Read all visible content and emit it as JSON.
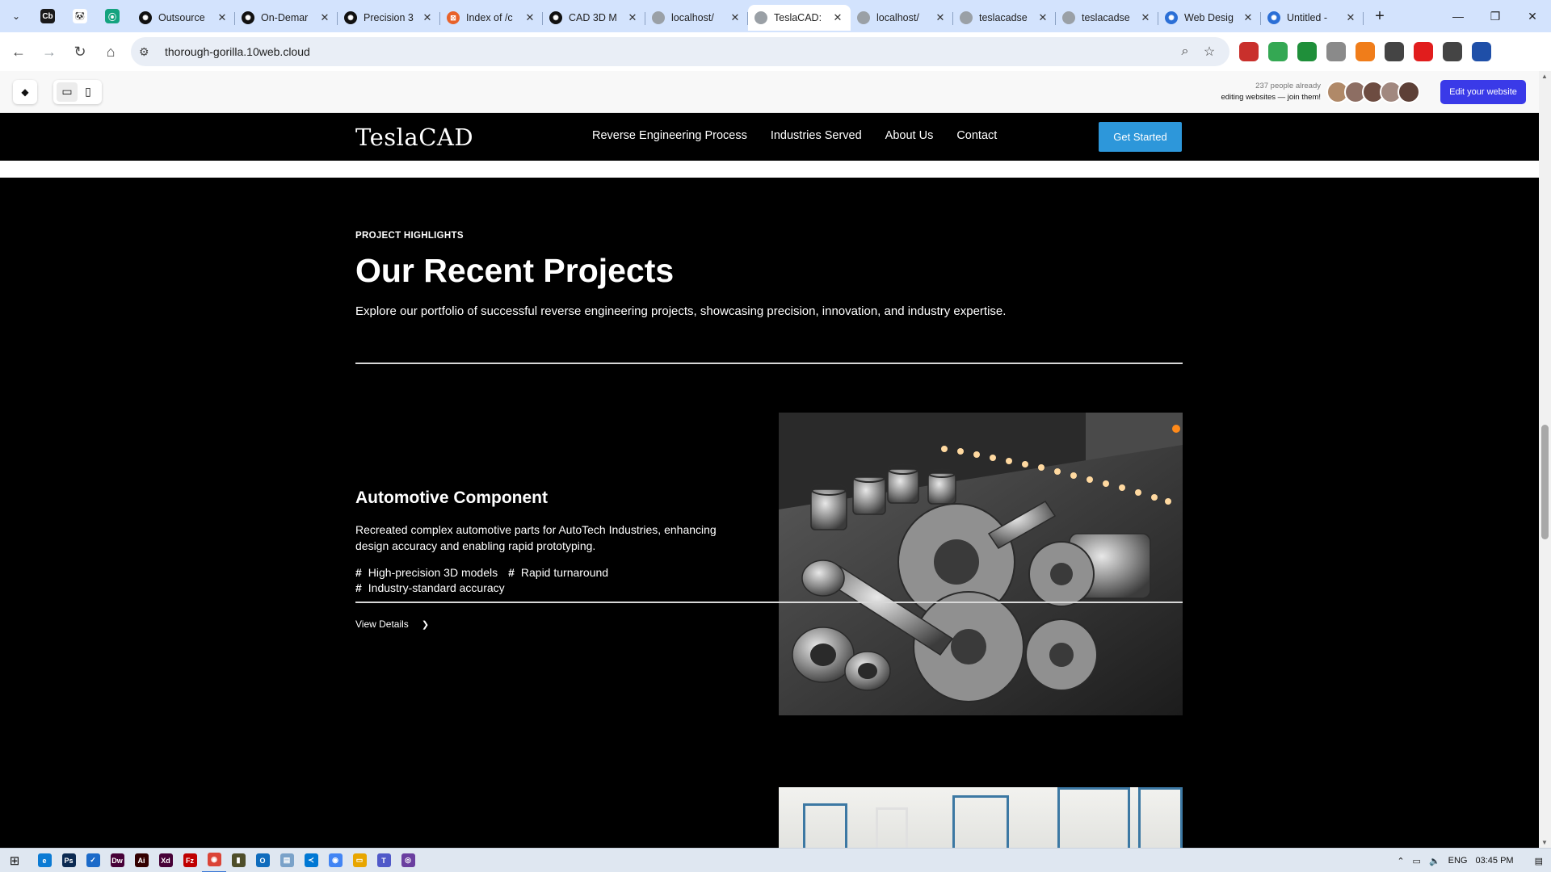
{
  "browser": {
    "pinned": [
      {
        "label": "Cb",
        "color": "#1a1a1a"
      },
      {
        "label": "🐼",
        "color": "#ffffff"
      },
      {
        "label": "⦿",
        "color": "#14a37f"
      }
    ],
    "tabs": [
      {
        "title": "Outsource",
        "color": "#111111",
        "glyph": "✺",
        "active": false
      },
      {
        "title": "On-Demar",
        "color": "#111111",
        "glyph": "✺",
        "active": false
      },
      {
        "title": "Precision 3",
        "color": "#111111",
        "glyph": "✺",
        "active": false
      },
      {
        "title": "Index of /c",
        "color": "#e8622a",
        "glyph": "⊠",
        "active": false
      },
      {
        "title": "CAD 3D M",
        "color": "#111111",
        "glyph": "✺",
        "active": false
      },
      {
        "title": "localhost/",
        "color": "#9aa0a6",
        "glyph": "",
        "active": false
      },
      {
        "title": "TeslaCAD:",
        "color": "#9aa0a6",
        "glyph": "",
        "active": true
      },
      {
        "title": "localhost/",
        "color": "#9aa0a6",
        "glyph": "",
        "active": false
      },
      {
        "title": "teslacadse",
        "color": "#9aa0a6",
        "glyph": "",
        "active": false
      },
      {
        "title": "teslacadse",
        "color": "#9aa0a6",
        "glyph": "",
        "active": false
      },
      {
        "title": "Web Desig",
        "color": "#2b6fd6",
        "glyph": "✺",
        "active": false
      },
      {
        "title": "Untitled -",
        "color": "#2b6fd6",
        "glyph": "✺",
        "active": false
      }
    ],
    "url": "thorough-gorilla.10web.cloud",
    "extensions": [
      {
        "icon": "ext-red-icon",
        "color": "#c9302c"
      },
      {
        "icon": "ext-plus-icon",
        "color": "#34a853"
      },
      {
        "icon": "ext-bw-icon",
        "color": "#1f8f3a"
      },
      {
        "icon": "camera-icon",
        "color": "#8a8a8a"
      },
      {
        "icon": "ext-orange-icon",
        "color": "#f07d1a"
      },
      {
        "icon": "ext-pen-icon",
        "color": "#444444"
      },
      {
        "icon": "opera-icon",
        "color": "#e11d1d"
      },
      {
        "icon": "puzzle-icon",
        "color": "#444444"
      },
      {
        "icon": "profile-icon",
        "color": "#1f4fa8"
      }
    ]
  },
  "editor": {
    "join_count": "237",
    "join_line1_rest": " people already",
    "join_line2": "editing websites — join them!",
    "avatar_colors": [
      "#b08968",
      "#8d6e63",
      "#6d4c41",
      "#a1887f",
      "#5d4037"
    ],
    "edit_button": "Edit your website"
  },
  "site": {
    "brand": "TeslaCAD",
    "menu": [
      "Reverse Engineering Process",
      "Industries Served",
      "About Us",
      "Contact"
    ],
    "cta": "Get Started",
    "eyebrow": "PROJECT HIGHLIGHTS",
    "heading": "Our Recent Projects",
    "lead": "Explore our portfolio of successful reverse engineering projects, showcasing precision, innovation, and industry expertise.",
    "project": {
      "title": "Automotive Component",
      "description": "Recreated complex automotive parts for AutoTech Industries, enhancing design accuracy and enabling rapid prototyping.",
      "tags": [
        "High-precision 3D models",
        "Rapid turnaround",
        "Industry-standard accuracy"
      ],
      "link": "View Details",
      "image_alt": "automotive-parts-photo"
    }
  },
  "taskbar": {
    "apps": [
      {
        "label": "e",
        "color": "#0c7bd4",
        "running": false
      },
      {
        "label": "Ps",
        "color": "#0b2a52",
        "running": false
      },
      {
        "label": "✓",
        "color": "#1b6ac9",
        "running": false
      },
      {
        "label": "Dw",
        "color": "#470137",
        "running": false
      },
      {
        "label": "Ai",
        "color": "#330000",
        "running": false
      },
      {
        "label": "Xd",
        "color": "#470137",
        "running": false
      },
      {
        "label": "Fz",
        "color": "#bf0000",
        "running": false
      },
      {
        "label": "◉",
        "color": "#db4437",
        "running": true
      },
      {
        "label": "▮",
        "color": "#4e4e2a",
        "running": false
      },
      {
        "label": "O",
        "color": "#0f6cbd",
        "running": false
      },
      {
        "label": "▤",
        "color": "#7aa2c9",
        "running": false
      },
      {
        "label": "≺",
        "color": "#0078d4",
        "running": false
      },
      {
        "label": "◉",
        "color": "#4285f4",
        "running": false
      },
      {
        "label": "▭",
        "color": "#e8a600",
        "running": false
      },
      {
        "label": "T",
        "color": "#5059c9",
        "running": false
      },
      {
        "label": "◎",
        "color": "#6b3fa0",
        "running": false
      }
    ],
    "lang": "ENG",
    "time": "03:45 PM"
  }
}
